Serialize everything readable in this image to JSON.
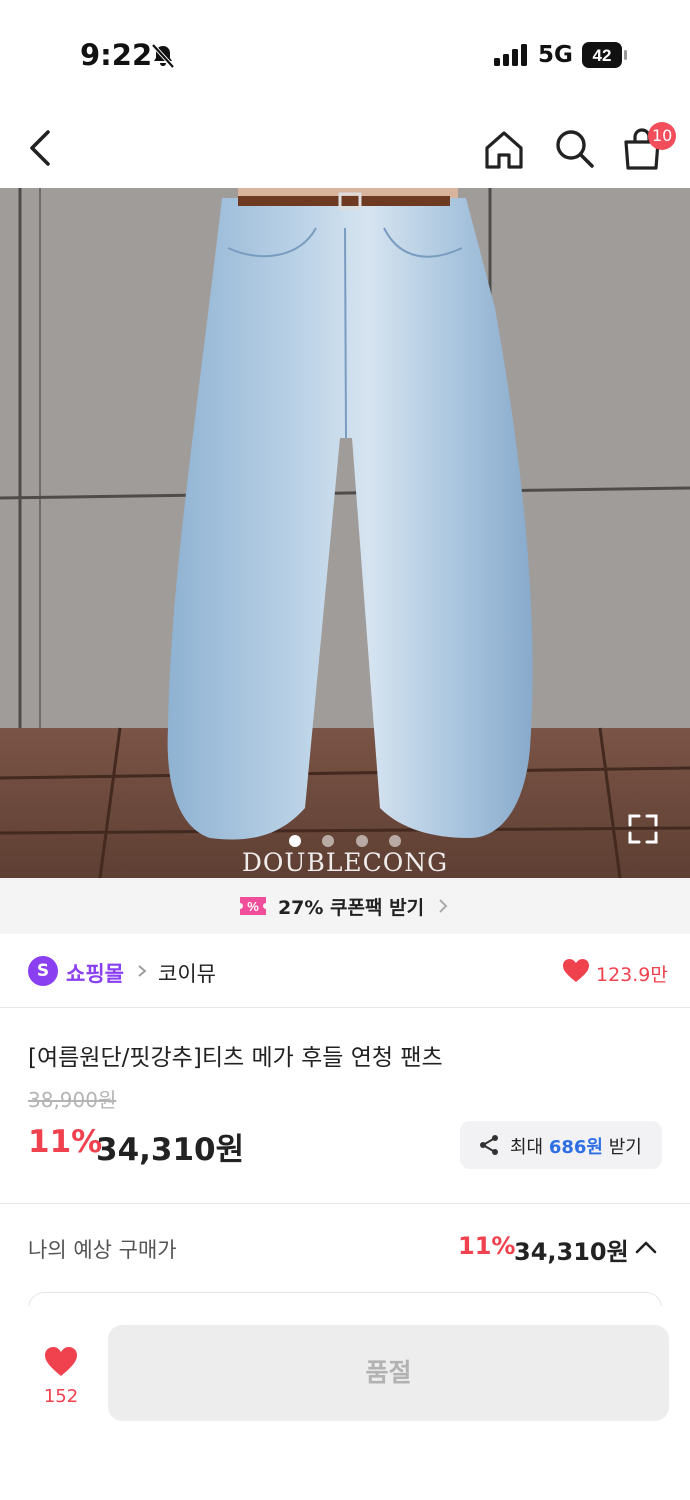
{
  "status_bar": {
    "time": "9:22",
    "network": "5G",
    "battery": "42"
  },
  "header": {
    "cart_count": "10",
    "icons": [
      "back-arrow-icon",
      "home-icon",
      "search-icon",
      "shopping-bag-icon"
    ]
  },
  "gallery": {
    "watermark": "DOUBLECONG",
    "slide_count": 4,
    "active_slide": 1
  },
  "coupon": {
    "label": "27% 쿠폰팩 받기"
  },
  "seller": {
    "badge": "S",
    "mall_label": "쇼핑몰",
    "store_name": "코이뮤",
    "likes": "123.9만"
  },
  "product": {
    "title": "[여름원단/핏강추]티츠 메가 후들 연청 팬츠",
    "original_price": "38,900원",
    "discount": "11%",
    "price": "34,310원",
    "share": {
      "prefix": "최대 ",
      "amount": "686원",
      "suffix": " 받기"
    }
  },
  "expected": {
    "label": "나의 예상 구매가",
    "discount": "11%",
    "price": "34,310원"
  },
  "bottom_bar": {
    "like_count": "152",
    "buy_label": "품절"
  },
  "colors": {
    "accent_red": "#f0414f",
    "mall_purple": "#8a3ff0",
    "link_blue": "#2f6fe4"
  }
}
